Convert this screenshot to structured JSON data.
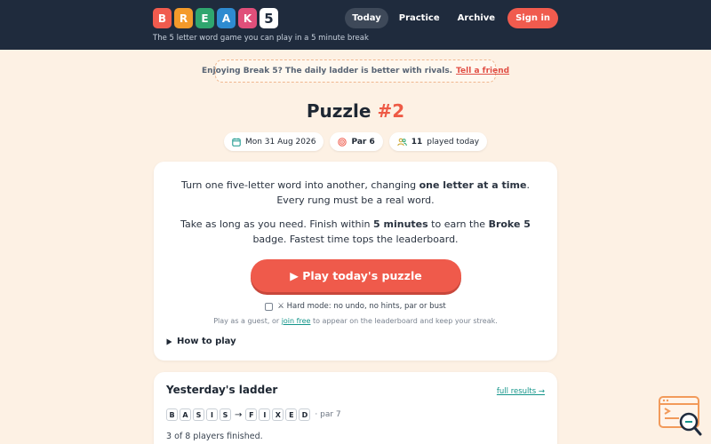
{
  "brand": {
    "letters": [
      {
        "char": "B",
        "color": "#f05b4e"
      },
      {
        "char": "R",
        "color": "#f49a2a"
      },
      {
        "char": "E",
        "color": "#2fa66f"
      },
      {
        "char": "A",
        "color": "#2e8bd0"
      },
      {
        "char": "K",
        "color": "#e04f7a"
      },
      {
        "char": "5",
        "color": "#ffffff"
      }
    ],
    "tagline": "The 5 letter word game you can play in a 5 minute break"
  },
  "nav": {
    "today": "Today",
    "practice": "Practice",
    "archive": "Archive",
    "signin": "Sign in"
  },
  "promo": {
    "text": "Enjoying Break 5? The daily ladder is better with rivals.",
    "link": "Tell a friend"
  },
  "puzzle": {
    "title_prefix": "Puzzle",
    "number": "#2",
    "date": "Mon 31 Aug 2026",
    "par": "Par 6",
    "played_count": "11",
    "played_suffix": "played today"
  },
  "intro": {
    "p1_a": "Turn one five-letter word into another, changing ",
    "p1_b": "one letter at a time",
    "p1_c": ". Every rung must be a real word.",
    "p2_a": "Take as long as you need. Finish within ",
    "p2_b": "5 minutes",
    "p2_c": " to earn the ",
    "p2_d": "Broke 5",
    "p2_e": " badge. Fastest time tops the leaderboard."
  },
  "play": {
    "label": "▶ Play today's puzzle",
    "hard_mode": "⚔ Hard mode: no undo, no hints, par or bust",
    "guest_a": "Play as a guest, or ",
    "guest_link": "join free",
    "guest_b": " to appear on the leaderboard and keep your streak.",
    "how_to": "How to play"
  },
  "yesterday": {
    "title": "Yesterday's ladder",
    "link": "full results →",
    "from_word": [
      "B",
      "A",
      "S",
      "I",
      "S"
    ],
    "to_word": [
      "F",
      "I",
      "X",
      "E",
      "D"
    ],
    "arrow": "→",
    "par": "· par 7",
    "finished": "3 of 8 players finished."
  },
  "colors": {
    "header": "#1f2b3d",
    "accent": "#ef5a4b",
    "teal": "#14958a",
    "background": "#fdf1e4"
  }
}
